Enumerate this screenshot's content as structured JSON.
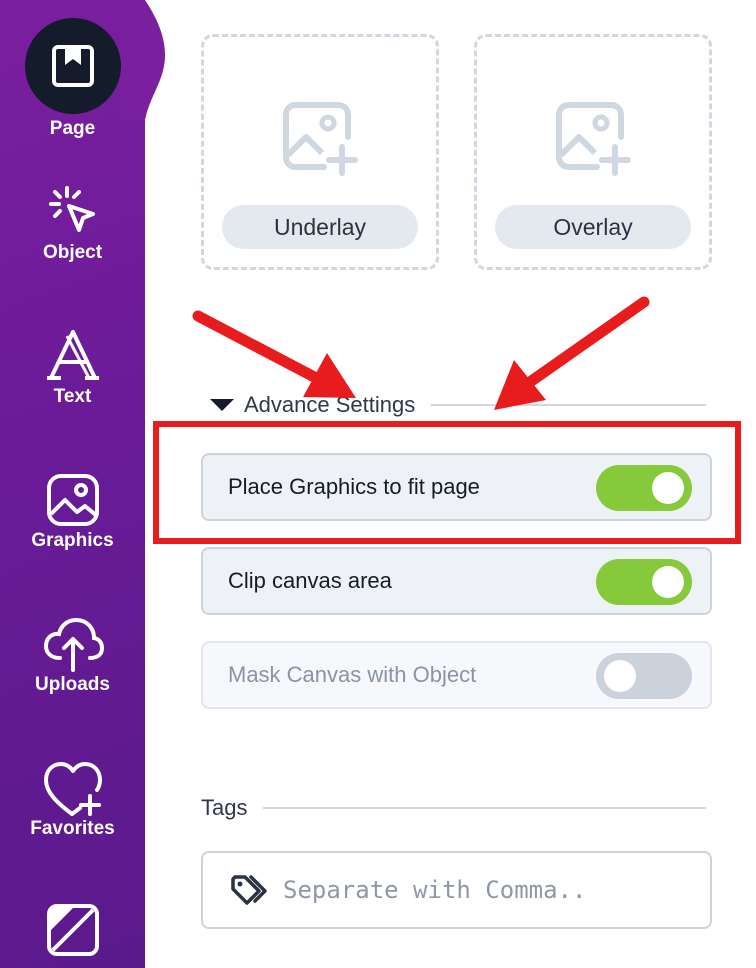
{
  "sidebar": {
    "items": [
      {
        "label": "Page",
        "icon": "bookmark-page-icon",
        "active": true
      },
      {
        "label": "Object",
        "icon": "cursor-click-icon"
      },
      {
        "label": "Text",
        "icon": "text-a-icon"
      },
      {
        "label": "Graphics",
        "icon": "image-icon"
      },
      {
        "label": "Uploads",
        "icon": "cloud-upload-icon"
      },
      {
        "label": "Favorites",
        "icon": "heart-plus-icon"
      },
      {
        "label": "",
        "icon": "background-slash-icon"
      }
    ]
  },
  "images": {
    "underlay_label": "Underlay",
    "overlay_label": "Overlay"
  },
  "advance_settings": {
    "title": "Advance Settings",
    "options": [
      {
        "label": "Place Graphics to fit page",
        "on": true,
        "disabled": false
      },
      {
        "label": "Clip canvas area",
        "on": true,
        "disabled": false
      },
      {
        "label": "Mask Canvas with Object",
        "on": false,
        "disabled": true
      }
    ]
  },
  "tags": {
    "title": "Tags",
    "placeholder": "Separate with Comma.."
  },
  "colors": {
    "sidebar": "#6a1b98",
    "toggle_on": "#86c93a",
    "toggle_off": "#cbd2dc",
    "annotation": "#e81c1c"
  }
}
